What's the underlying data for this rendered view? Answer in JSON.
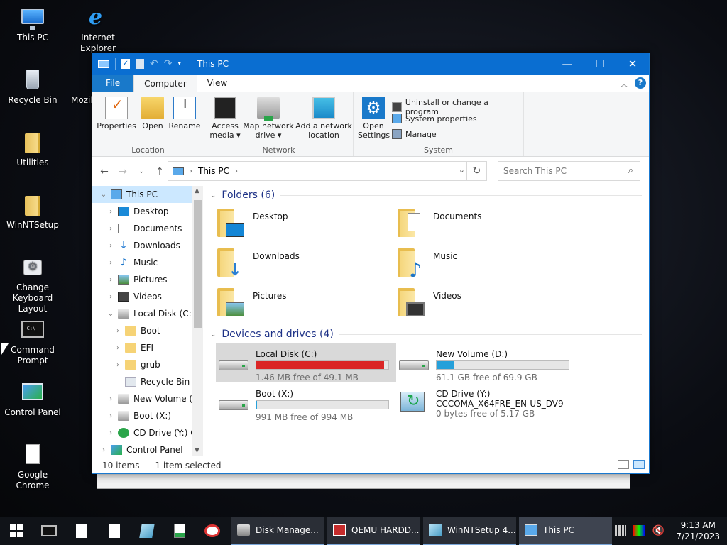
{
  "desktop": {
    "icons": [
      {
        "label": "This PC",
        "icon": "this-pc-icon"
      },
      {
        "label": "Internet Explorer",
        "icon": "internet-explorer-icon"
      },
      {
        "label": "Recycle Bin",
        "icon": "recycle-bin-icon"
      },
      {
        "label": "Mozil",
        "icon": "mozilla-icon"
      },
      {
        "label": "Utilities",
        "icon": "folder-icon"
      },
      {
        "label": "WinNTSetup",
        "icon": "folder-icon"
      },
      {
        "label": "Change Keyboard Layout",
        "icon": "keyboard-settings-icon"
      },
      {
        "label": "Command Prompt",
        "icon": "command-prompt-icon"
      },
      {
        "label": "Control Panel",
        "icon": "control-panel-icon"
      },
      {
        "label": "Google Chrome",
        "icon": "file-icon"
      }
    ]
  },
  "window": {
    "title": "This PC",
    "controls": {
      "minimize": "—",
      "maximize": "☐",
      "close": "✕"
    }
  },
  "ribbon": {
    "tabs": [
      "File",
      "Computer",
      "View"
    ],
    "active_tab": "Computer",
    "help": "?",
    "groups": {
      "location": {
        "label": "Location",
        "buttons": [
          "Properties",
          "Open",
          "Rename"
        ]
      },
      "network": {
        "label": "Network",
        "buttons": [
          {
            "line1": "Access",
            "line2": "media ▾"
          },
          {
            "line1": "Map network",
            "line2": "drive ▾"
          },
          {
            "line1": "Add a network",
            "line2": "location"
          }
        ]
      },
      "system": {
        "label": "System",
        "open_settings_line1": "Open",
        "open_settings_line2": "Settings",
        "small_buttons": [
          "Uninstall or change a program",
          "System properties",
          "Manage"
        ]
      }
    }
  },
  "address": {
    "path": "This PC",
    "search_placeholder": "Search This PC"
  },
  "nav_pane": {
    "items": [
      {
        "label": "This PC",
        "level": 0,
        "chevron": "⌄",
        "icon": "pc",
        "selected": true
      },
      {
        "label": "Desktop",
        "level": 1,
        "chevron": "›",
        "icon": "desk"
      },
      {
        "label": "Documents",
        "level": 1,
        "chevron": "›",
        "icon": "docs"
      },
      {
        "label": "Downloads",
        "level": 1,
        "chevron": "›",
        "icon": "down"
      },
      {
        "label": "Music",
        "level": 1,
        "chevron": "›",
        "icon": "music"
      },
      {
        "label": "Pictures",
        "level": 1,
        "chevron": "›",
        "icon": "pics"
      },
      {
        "label": "Videos",
        "level": 1,
        "chevron": "›",
        "icon": "vid"
      },
      {
        "label": "Local Disk (C:)",
        "level": 1,
        "chevron": "⌄",
        "icon": "drive"
      },
      {
        "label": "Boot",
        "level": 2,
        "chevron": "›",
        "icon": "folder"
      },
      {
        "label": "EFI",
        "level": 2,
        "chevron": "›",
        "icon": "folder"
      },
      {
        "label": "grub",
        "level": 2,
        "chevron": "›",
        "icon": "folder"
      },
      {
        "label": "Recycle Bin",
        "level": 2,
        "chevron": "",
        "icon": "bin"
      },
      {
        "label": "New Volume (D",
        "level": 1,
        "chevron": "›",
        "icon": "drive"
      },
      {
        "label": "Boot (X:)",
        "level": 1,
        "chevron": "›",
        "icon": "drive"
      },
      {
        "label": "CD Drive (Y:) C",
        "level": 1,
        "chevron": "›",
        "icon": "cd"
      },
      {
        "label": "Control Panel",
        "level": 0,
        "chevron": "›",
        "icon": "cp"
      }
    ]
  },
  "content": {
    "folders_header": "Folders (6)",
    "folders": [
      {
        "name": "Desktop",
        "overlay": "desk"
      },
      {
        "name": "Documents",
        "overlay": "docs"
      },
      {
        "name": "Downloads",
        "overlay": "down"
      },
      {
        "name": "Music",
        "overlay": "music"
      },
      {
        "name": "Pictures",
        "overlay": "pics"
      },
      {
        "name": "Videos",
        "overlay": "vid"
      }
    ],
    "drives_header": "Devices and drives (4)",
    "drives": [
      {
        "name": "Local Disk (C:)",
        "free": "1.46 MB free of 49.1 MB",
        "used_fraction": 0.97,
        "critical": true,
        "selected": true,
        "kind": "hdd"
      },
      {
        "name": "New Volume (D:)",
        "free": "61.1 GB free of 69.9 GB",
        "used_fraction": 0.13,
        "critical": false,
        "kind": "hdd"
      },
      {
        "name": "Boot (X:)",
        "free": "991 MB free of 994 MB",
        "used_fraction": 0.003,
        "critical": false,
        "kind": "hdd"
      },
      {
        "name": "CD Drive (Y:)",
        "label2": "CCCOMA_X64FRE_EN-US_DV9",
        "free": "0 bytes free of 5.17 GB",
        "kind": "cd"
      }
    ]
  },
  "status": {
    "items": "10 items",
    "selected": "1 item selected"
  },
  "taskbar": {
    "tasks": [
      {
        "label": "Disk Manage...",
        "icon": "disk"
      },
      {
        "label": "QEMU HARDD...",
        "icon": "qemu"
      },
      {
        "label": "WinNTSetup 4....",
        "icon": "nt"
      },
      {
        "label": "This PC",
        "icon": "pc",
        "active": true
      }
    ],
    "time": "9:13 AM",
    "date": "7/21/2023"
  },
  "colors": {
    "titlebar": "#0a6ed1",
    "accent": "#1979ca",
    "drive_bar": "#26a0da",
    "drive_bar_critical": "#da2626",
    "selection": "#cce8ff"
  }
}
